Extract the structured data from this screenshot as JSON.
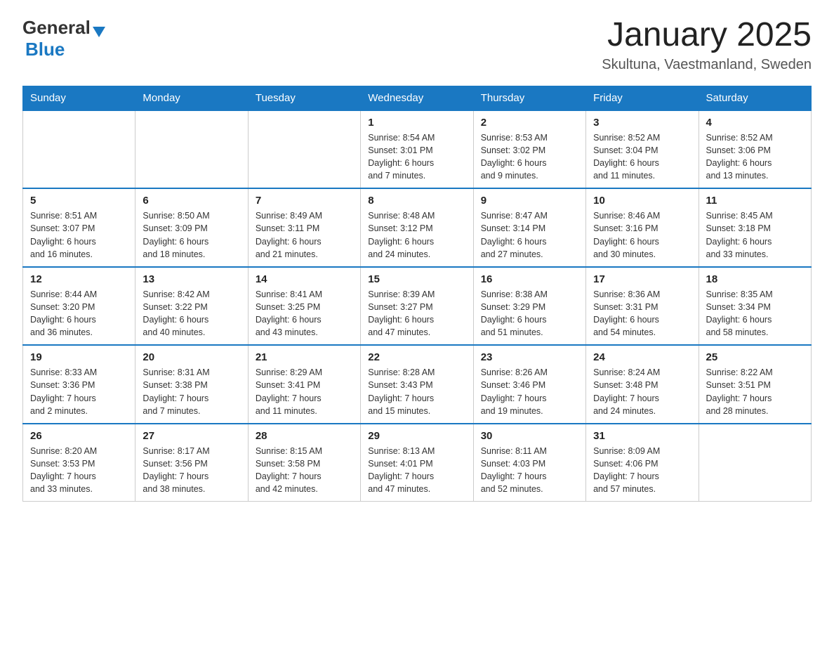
{
  "header": {
    "logo_general": "General",
    "logo_blue": "Blue",
    "title": "January 2025",
    "subtitle": "Skultuna, Vaestmanland, Sweden"
  },
  "days_of_week": [
    "Sunday",
    "Monday",
    "Tuesday",
    "Wednesday",
    "Thursday",
    "Friday",
    "Saturday"
  ],
  "weeks": [
    {
      "days": [
        {
          "number": "",
          "info": ""
        },
        {
          "number": "",
          "info": ""
        },
        {
          "number": "",
          "info": ""
        },
        {
          "number": "1",
          "info": "Sunrise: 8:54 AM\nSunset: 3:01 PM\nDaylight: 6 hours\nand 7 minutes."
        },
        {
          "number": "2",
          "info": "Sunrise: 8:53 AM\nSunset: 3:02 PM\nDaylight: 6 hours\nand 9 minutes."
        },
        {
          "number": "3",
          "info": "Sunrise: 8:52 AM\nSunset: 3:04 PM\nDaylight: 6 hours\nand 11 minutes."
        },
        {
          "number": "4",
          "info": "Sunrise: 8:52 AM\nSunset: 3:06 PM\nDaylight: 6 hours\nand 13 minutes."
        }
      ]
    },
    {
      "days": [
        {
          "number": "5",
          "info": "Sunrise: 8:51 AM\nSunset: 3:07 PM\nDaylight: 6 hours\nand 16 minutes."
        },
        {
          "number": "6",
          "info": "Sunrise: 8:50 AM\nSunset: 3:09 PM\nDaylight: 6 hours\nand 18 minutes."
        },
        {
          "number": "7",
          "info": "Sunrise: 8:49 AM\nSunset: 3:11 PM\nDaylight: 6 hours\nand 21 minutes."
        },
        {
          "number": "8",
          "info": "Sunrise: 8:48 AM\nSunset: 3:12 PM\nDaylight: 6 hours\nand 24 minutes."
        },
        {
          "number": "9",
          "info": "Sunrise: 8:47 AM\nSunset: 3:14 PM\nDaylight: 6 hours\nand 27 minutes."
        },
        {
          "number": "10",
          "info": "Sunrise: 8:46 AM\nSunset: 3:16 PM\nDaylight: 6 hours\nand 30 minutes."
        },
        {
          "number": "11",
          "info": "Sunrise: 8:45 AM\nSunset: 3:18 PM\nDaylight: 6 hours\nand 33 minutes."
        }
      ]
    },
    {
      "days": [
        {
          "number": "12",
          "info": "Sunrise: 8:44 AM\nSunset: 3:20 PM\nDaylight: 6 hours\nand 36 minutes."
        },
        {
          "number": "13",
          "info": "Sunrise: 8:42 AM\nSunset: 3:22 PM\nDaylight: 6 hours\nand 40 minutes."
        },
        {
          "number": "14",
          "info": "Sunrise: 8:41 AM\nSunset: 3:25 PM\nDaylight: 6 hours\nand 43 minutes."
        },
        {
          "number": "15",
          "info": "Sunrise: 8:39 AM\nSunset: 3:27 PM\nDaylight: 6 hours\nand 47 minutes."
        },
        {
          "number": "16",
          "info": "Sunrise: 8:38 AM\nSunset: 3:29 PM\nDaylight: 6 hours\nand 51 minutes."
        },
        {
          "number": "17",
          "info": "Sunrise: 8:36 AM\nSunset: 3:31 PM\nDaylight: 6 hours\nand 54 minutes."
        },
        {
          "number": "18",
          "info": "Sunrise: 8:35 AM\nSunset: 3:34 PM\nDaylight: 6 hours\nand 58 minutes."
        }
      ]
    },
    {
      "days": [
        {
          "number": "19",
          "info": "Sunrise: 8:33 AM\nSunset: 3:36 PM\nDaylight: 7 hours\nand 2 minutes."
        },
        {
          "number": "20",
          "info": "Sunrise: 8:31 AM\nSunset: 3:38 PM\nDaylight: 7 hours\nand 7 minutes."
        },
        {
          "number": "21",
          "info": "Sunrise: 8:29 AM\nSunset: 3:41 PM\nDaylight: 7 hours\nand 11 minutes."
        },
        {
          "number": "22",
          "info": "Sunrise: 8:28 AM\nSunset: 3:43 PM\nDaylight: 7 hours\nand 15 minutes."
        },
        {
          "number": "23",
          "info": "Sunrise: 8:26 AM\nSunset: 3:46 PM\nDaylight: 7 hours\nand 19 minutes."
        },
        {
          "number": "24",
          "info": "Sunrise: 8:24 AM\nSunset: 3:48 PM\nDaylight: 7 hours\nand 24 minutes."
        },
        {
          "number": "25",
          "info": "Sunrise: 8:22 AM\nSunset: 3:51 PM\nDaylight: 7 hours\nand 28 minutes."
        }
      ]
    },
    {
      "days": [
        {
          "number": "26",
          "info": "Sunrise: 8:20 AM\nSunset: 3:53 PM\nDaylight: 7 hours\nand 33 minutes."
        },
        {
          "number": "27",
          "info": "Sunrise: 8:17 AM\nSunset: 3:56 PM\nDaylight: 7 hours\nand 38 minutes."
        },
        {
          "number": "28",
          "info": "Sunrise: 8:15 AM\nSunset: 3:58 PM\nDaylight: 7 hours\nand 42 minutes."
        },
        {
          "number": "29",
          "info": "Sunrise: 8:13 AM\nSunset: 4:01 PM\nDaylight: 7 hours\nand 47 minutes."
        },
        {
          "number": "30",
          "info": "Sunrise: 8:11 AM\nSunset: 4:03 PM\nDaylight: 7 hours\nand 52 minutes."
        },
        {
          "number": "31",
          "info": "Sunrise: 8:09 AM\nSunset: 4:06 PM\nDaylight: 7 hours\nand 57 minutes."
        },
        {
          "number": "",
          "info": ""
        }
      ]
    }
  ]
}
